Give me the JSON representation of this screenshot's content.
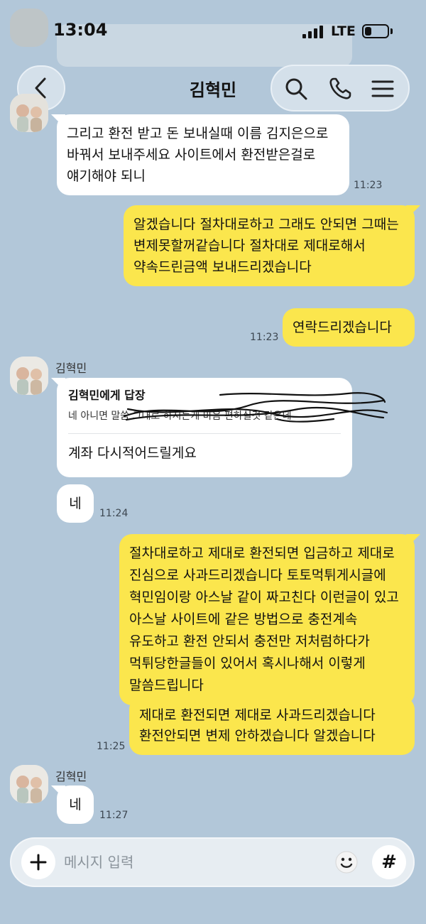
{
  "status_bar": {
    "time": "13:04",
    "network": "LTE",
    "signal_bars": 4,
    "battery_level": 0.3
  },
  "header": {
    "title": "김혁민"
  },
  "messages": [
    {
      "text": "그리고 환전 받고 돈 보내실때 이름 김지은으로 바꿔서 보내주세요 사이트에서 환전받은걸로 얘기해야 되니",
      "time": "11:23"
    },
    {
      "text": "알겠습니다 절차대로하고 그래도 안되면 그때는 변제못할꺼같습니다 절차대로 제대로해서 약속드린금액 보내드리겠습니다"
    },
    {
      "text": "연락드리겠습니다",
      "time": "11:23"
    },
    {
      "sender": "김혁민",
      "reply_title": "김혁민에게 답장",
      "reply_quote": "네 아니면 말씀 그대로 하시는게 마음 편하실것 같은데",
      "text": "계좌 다시적어드릴게요"
    },
    {
      "text": "네",
      "time": "11:24"
    },
    {
      "text": "절차대로하고 제대로 환전되면 입금하고 제대로 진심으로 사과드리겠습니다 토토먹튀게시글에 혁민임이랑 아스날 같이 짜고친다 이런글이 있고 아스날 사이트에 같은 방법으로 충전계속 유도하고 환전 안되서 충전만 저처럼하다가 먹튀당한글들이 있어서 혹시나해서 이렇게 말씀드립니다"
    },
    {
      "text": "제대로 환전되면 제대로 사과드리겠습니다 환전안되면 변제 안하겠습니다 알겠습니다",
      "time": "11:25"
    },
    {
      "sender": "김혁민",
      "text": "네",
      "time": "11:27"
    }
  ],
  "input": {
    "placeholder": "메시지 입력",
    "value": ""
  }
}
